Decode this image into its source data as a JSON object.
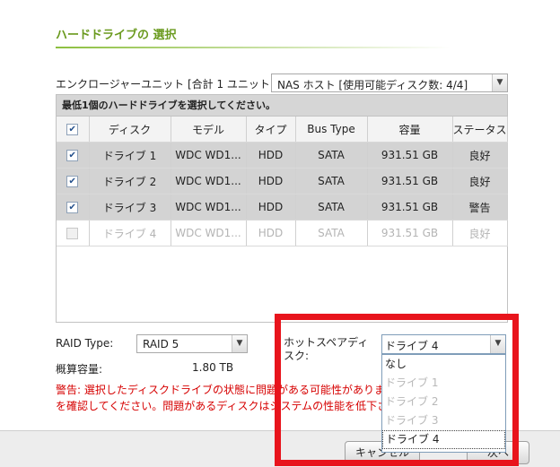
{
  "title": "ハードドライブの 選択",
  "enclosure": {
    "label": "エンクロージャーユニット [合計 1 ユニット]:",
    "selected": "NAS ホスト [使用可能ディスク数: 4/4]"
  },
  "panel": {
    "header": "最低1個のハードドライブを選択してください。",
    "columns": [
      "ディスク",
      "モデル",
      "タイプ",
      "Bus Type",
      "容量",
      "ステータス"
    ],
    "rows": [
      {
        "disk": "ドライブ 1",
        "model": "WDC WD1...",
        "type": "HDD",
        "bus": "SATA",
        "capacity": "931.51 GB",
        "status": "良好",
        "checked": true,
        "enabled": true
      },
      {
        "disk": "ドライブ 2",
        "model": "WDC WD1...",
        "type": "HDD",
        "bus": "SATA",
        "capacity": "931.51 GB",
        "status": "良好",
        "checked": true,
        "enabled": true
      },
      {
        "disk": "ドライブ 3",
        "model": "WDC WD1...",
        "type": "HDD",
        "bus": "SATA",
        "capacity": "931.51 GB",
        "status": "警告",
        "checked": true,
        "enabled": true
      },
      {
        "disk": "ドライブ 4",
        "model": "WDC WD1...",
        "type": "HDD",
        "bus": "SATA",
        "capacity": "931.51 GB",
        "status": "良好",
        "checked": false,
        "enabled": false
      }
    ]
  },
  "raid": {
    "label": "RAID Type:",
    "value": "RAID 5"
  },
  "capacity": {
    "label": "概算容量:",
    "value": "1.80 TB"
  },
  "hotspare": {
    "label": "ホットスペアディスク:",
    "value": "ドライブ 4",
    "options": [
      {
        "label": "なし",
        "enabled": true
      },
      {
        "label": "ドライブ 1",
        "enabled": false
      },
      {
        "label": "ドライブ 2",
        "enabled": false
      },
      {
        "label": "ドライブ 3",
        "enabled": false
      },
      {
        "label": "ドライブ 4",
        "enabled": true,
        "focused": true
      }
    ]
  },
  "warning": {
    "line1": "警告: 選択したディスクドライブの状態に問題がある可能性があります",
    "line2": "を確認してください。問題があるディスクはシステムの性能を低下させ"
  },
  "buttons": {
    "cancel": "キャンセル",
    "next": "次へ"
  },
  "colors": {
    "title": "#6a9a1e",
    "warning": "#d60000",
    "highlight": "#e8141c"
  }
}
